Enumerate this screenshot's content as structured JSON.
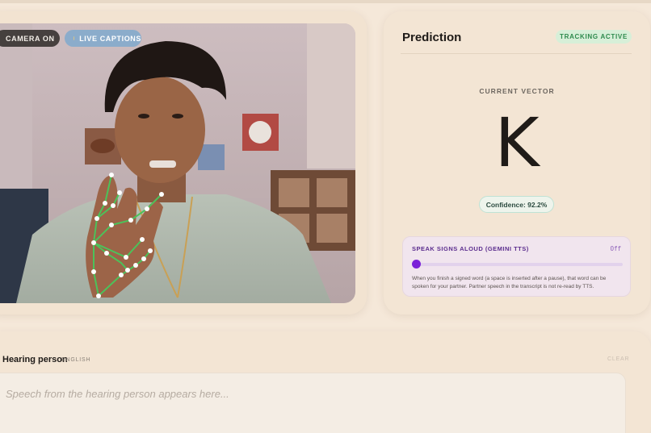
{
  "camera": {
    "status_label": "CAMERA ON",
    "captions_label": "LIVE CAPTIONS"
  },
  "prediction": {
    "title": "Prediction",
    "tracking_badge": "TRACKING ACTIVE",
    "vector_label": "CURRENT VECTOR",
    "letter": "K",
    "confidence": "Confidence: 92.2%"
  },
  "tts": {
    "title": "SPEAK SIGNS ALOUD (GEMINI TTS)",
    "state": "Off",
    "enabled": false,
    "description": "When you finish a signed word (a space is inserted after a pause), that word can be spoken for your partner. Partner speech in the transcript is not re-read by TTS."
  },
  "hearing": {
    "title": "Hearing person",
    "language": "ENGLISH",
    "clear_label": "CLEAR",
    "placeholder": "Speech from the hearing person appears here..."
  },
  "colors": {
    "background": "#f5e8d9",
    "tracking_green": "#2e8a4d",
    "tts_purple": "#7b22d8",
    "landmark_green": "#4cc25a"
  }
}
